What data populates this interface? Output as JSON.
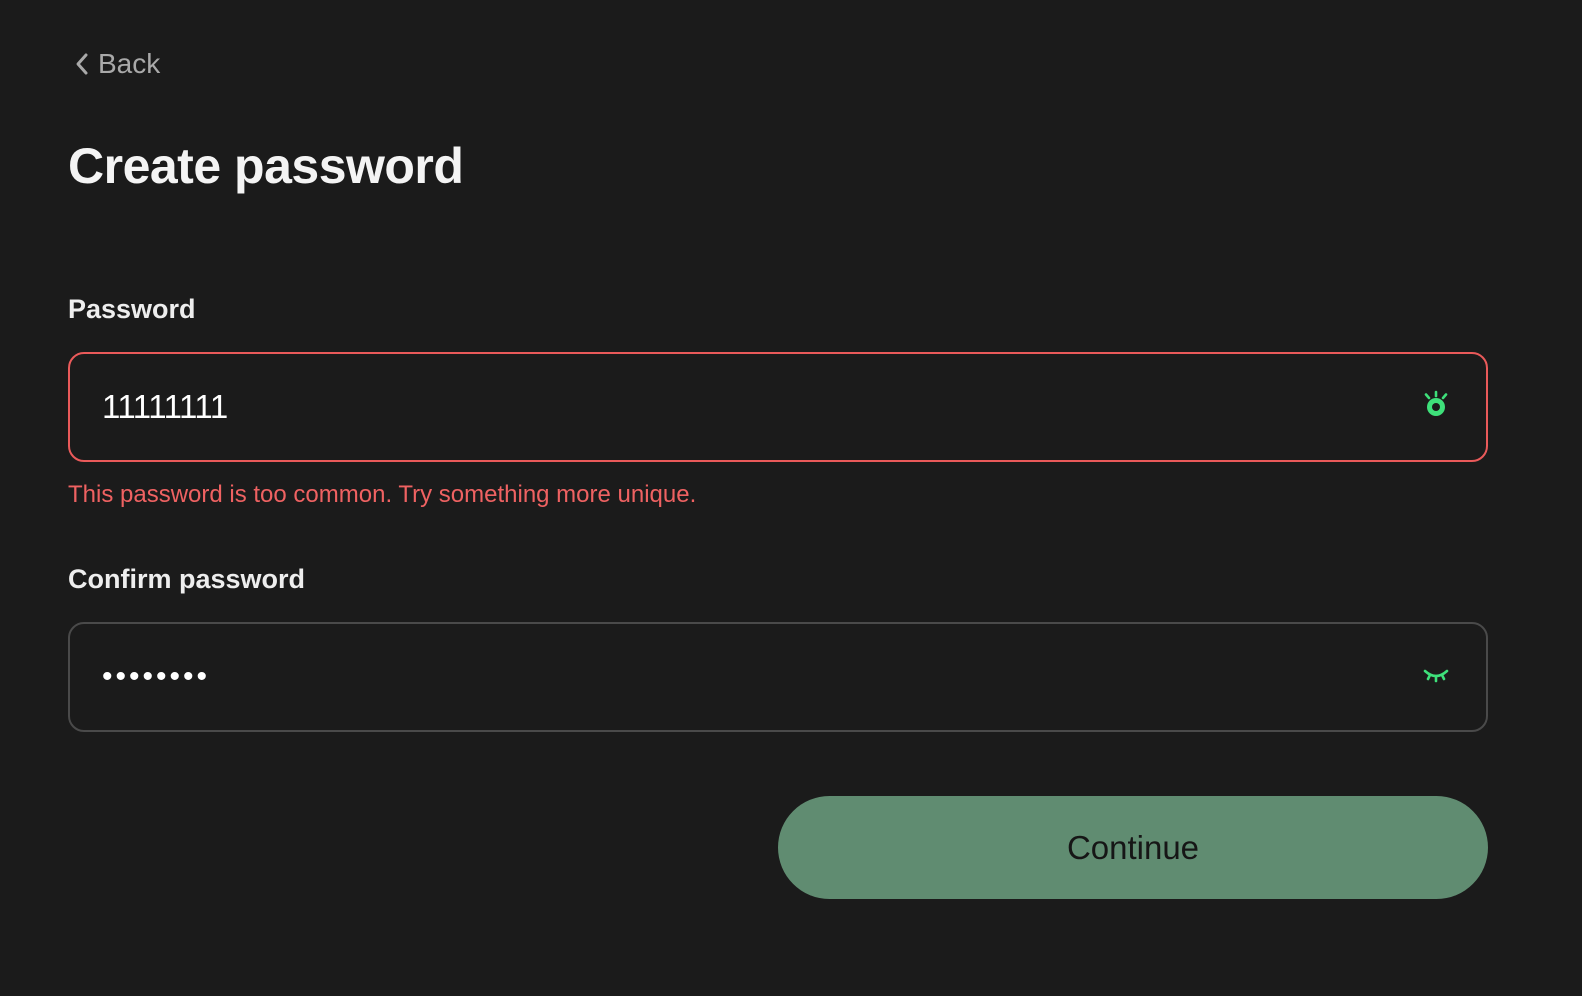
{
  "nav": {
    "back_label": "Back"
  },
  "header": {
    "title": "Create password"
  },
  "form": {
    "password": {
      "label": "Password",
      "value": "11111111",
      "visibility": "shown",
      "error": "This password is too common. Try something more unique."
    },
    "confirm_password": {
      "label": "Confirm password",
      "value": "11111111",
      "visibility": "hidden"
    },
    "continue_label": "Continue"
  },
  "icons": {
    "back": "chevron-left-icon",
    "password_toggle": "eye-open-icon",
    "confirm_toggle": "eye-closed-icon"
  },
  "colors": {
    "background": "#1b1b1b",
    "error": "#ef6262",
    "accent_green": "#3ee07a",
    "button_bg": "#608c71",
    "field_border": "#4a4a4a",
    "field_border_error": "#ea5a5a"
  }
}
